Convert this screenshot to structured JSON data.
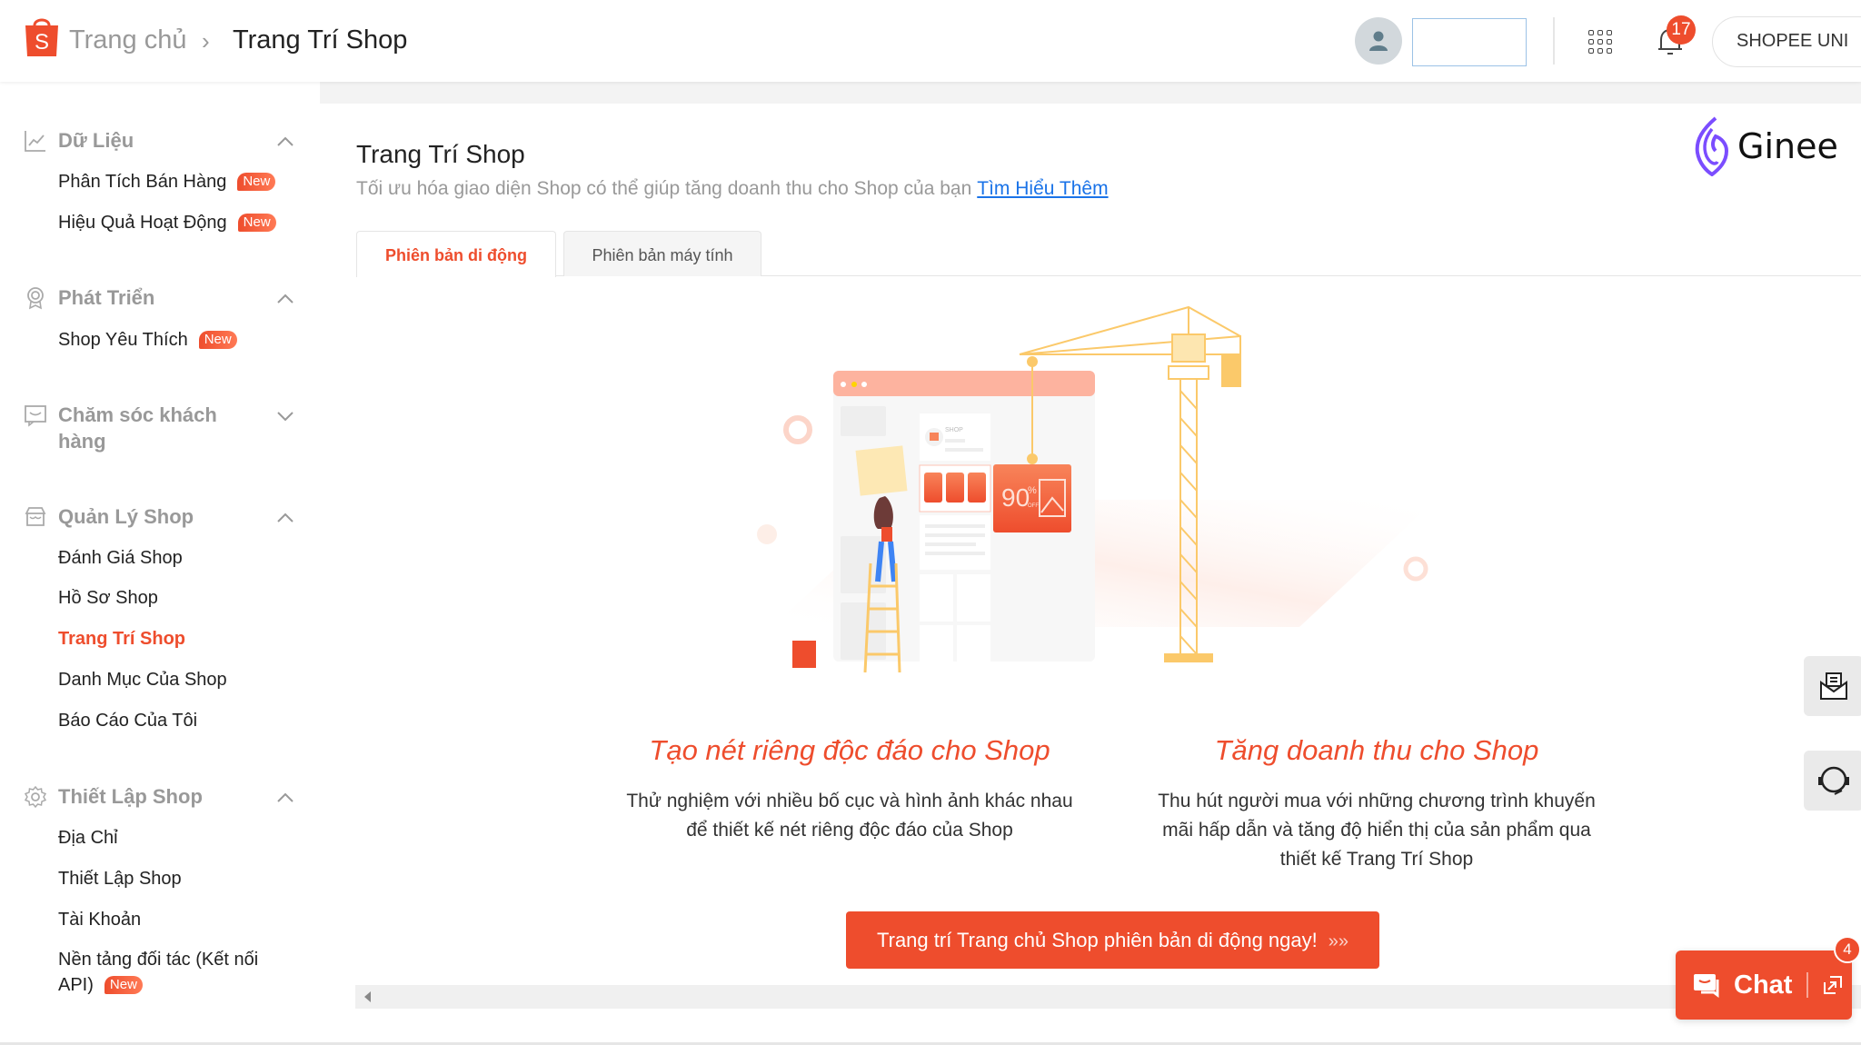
{
  "header": {
    "breadcrumb_home": "Trang chủ",
    "breadcrumb_separator": "›",
    "breadcrumb_current": "Trang Trí Shop",
    "user_name": "",
    "notification_count": "17",
    "shopee_uni_label": "SHOPEE UNI"
  },
  "sidebar": {
    "sections": [
      {
        "title": "Dữ Liệu",
        "icon": "chart-line-icon",
        "expanded": true,
        "items": [
          {
            "label": "Phân Tích Bán Hàng",
            "badge": "New"
          },
          {
            "label": "Hiệu Quả Hoạt Động",
            "badge": "New"
          }
        ]
      },
      {
        "title": "Phát Triển",
        "icon": "medal-icon",
        "expanded": true,
        "items": [
          {
            "label": "Shop Yêu Thích",
            "badge": "New"
          }
        ]
      },
      {
        "title": "Chăm sóc khách hàng",
        "icon": "chat-box-icon",
        "expanded": false,
        "items": []
      },
      {
        "title": "Quản Lý Shop",
        "icon": "store-icon",
        "expanded": true,
        "items": [
          {
            "label": "Đánh Giá Shop"
          },
          {
            "label": "Hồ Sơ Shop"
          },
          {
            "label": "Trang Trí Shop",
            "active": true
          },
          {
            "label": "Danh Mục Của Shop"
          },
          {
            "label": "Báo Cáo Của Tôi"
          }
        ]
      },
      {
        "title": "Thiết Lập Shop",
        "icon": "gear-icon",
        "expanded": true,
        "items": [
          {
            "label": "Địa Chỉ"
          },
          {
            "label": "Thiết Lập Shop"
          },
          {
            "label": "Tài Khoản"
          },
          {
            "label": "Nền tảng đối tác (Kết nối API)",
            "badge": "New"
          }
        ]
      }
    ]
  },
  "main": {
    "title": "Trang Trí Shop",
    "description": "Tối ưu hóa giao diện Shop có thể giúp tăng doanh thu cho Shop của bạn",
    "learn_more_link": "Tìm Hiểu Thêm",
    "brand_logo_text": "Ginee",
    "tabs": [
      {
        "label": "Phiên bản di động",
        "active": true
      },
      {
        "label": "Phiên bản máy tính",
        "active": false
      }
    ],
    "illustration": {
      "shop_label": "SHOP",
      "discount_value": "90",
      "discount_percent": "%",
      "discount_off": "OFF"
    },
    "features": [
      {
        "title": "Tạo nét riêng độc đáo cho Shop",
        "desc_line1": "Thử nghiệm với nhiều bố cục và hình ảnh khác nhau",
        "desc_line2": "để thiết kế nét riêng độc đáo của Shop"
      },
      {
        "title": "Tăng doanh thu cho Shop",
        "desc_line1": "Thu hút người mua với những chương trình khuyến",
        "desc_line2": "mãi hấp dẫn và tăng độ hiển thị của sản phẩm qua",
        "desc_line3": "thiết kế Trang Trí Shop"
      }
    ],
    "cta_label": "Trang trí Trang chủ Shop phiên bản di động ngay!",
    "cta_arrows": "»»"
  },
  "floating": {
    "chat_label": "Chat",
    "chat_badge": "4"
  },
  "colors": {
    "brand": "#ee4d2d",
    "link": "#1a73e8",
    "ginee_purple": "#7b4dff",
    "crane_yellow": "#fbc96a"
  }
}
